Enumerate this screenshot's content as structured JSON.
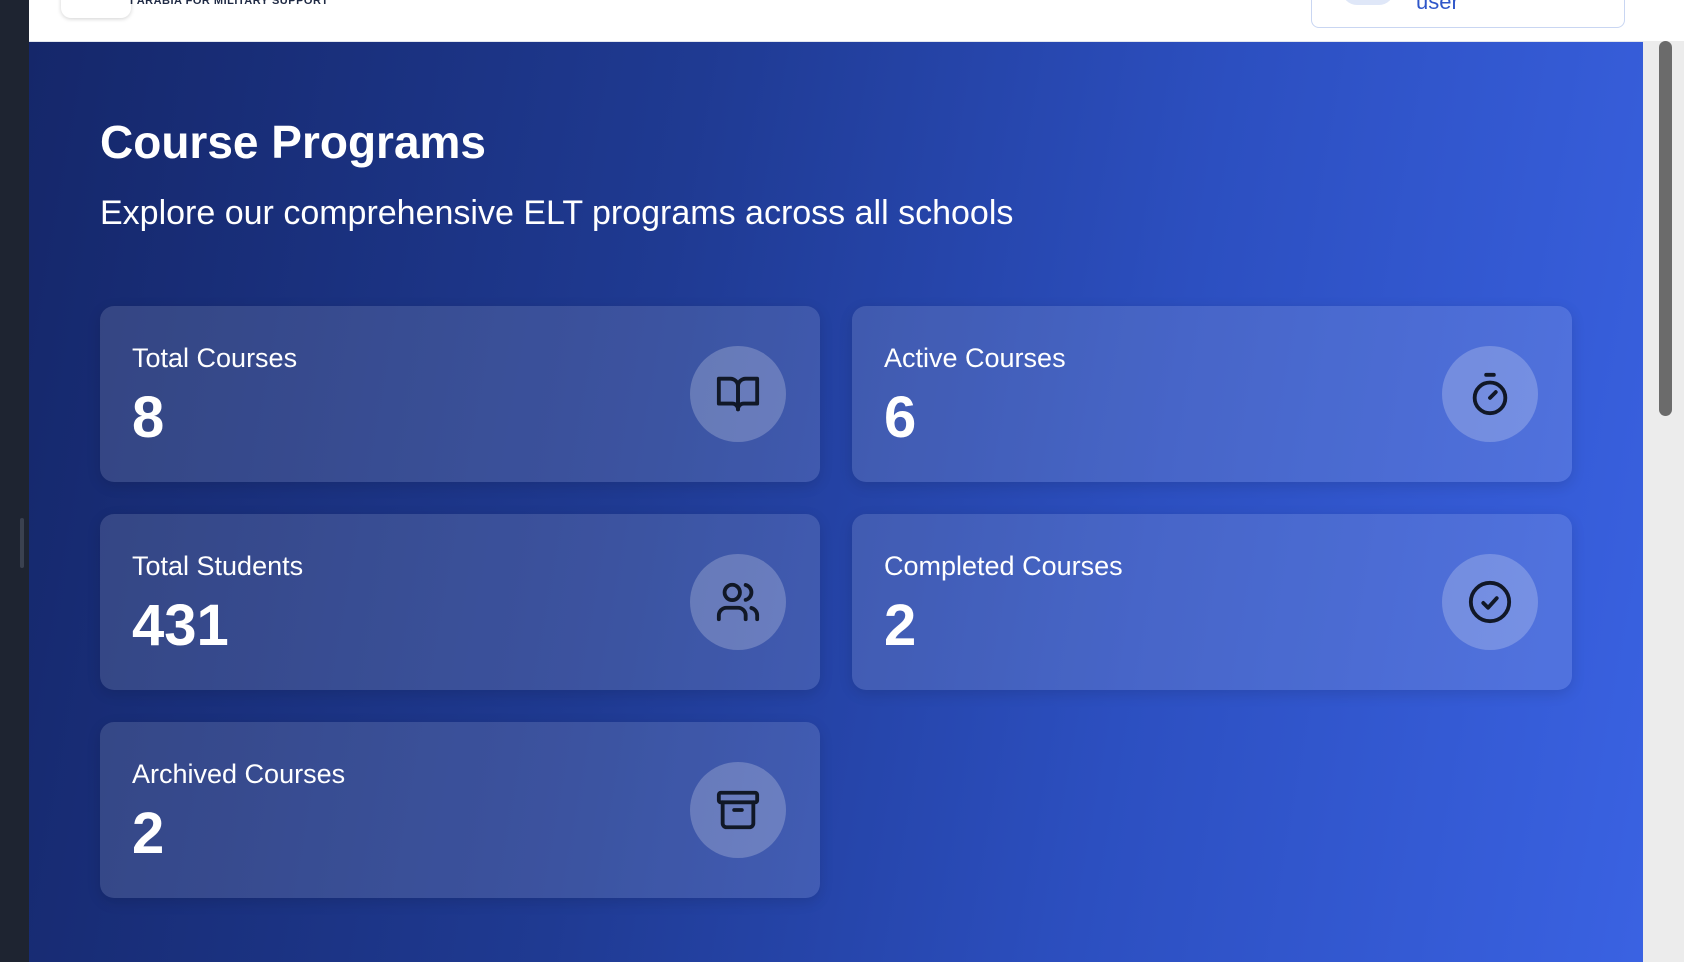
{
  "header": {
    "org_name": "I ARABIA FOR MILITARY SUPPORT",
    "user_label": "user"
  },
  "hero": {
    "title": "Course Programs",
    "subtitle": "Explore our comprehensive ELT programs across all schools"
  },
  "stats": [
    {
      "label": "Total Courses",
      "value": "8",
      "icon": "book-open-icon"
    },
    {
      "label": "Active Courses",
      "value": "6",
      "icon": "stopwatch-icon"
    },
    {
      "label": "Total Students",
      "value": "431",
      "icon": "users-icon"
    },
    {
      "label": "Completed Courses",
      "value": "2",
      "icon": "check-circle-icon"
    },
    {
      "label": "Archived Courses",
      "value": "2",
      "icon": "archive-icon"
    }
  ],
  "colors": {
    "hero_gradient_start": "#15276a",
    "hero_gradient_end": "#3a62e2",
    "accent_text": "#2f56c9"
  }
}
